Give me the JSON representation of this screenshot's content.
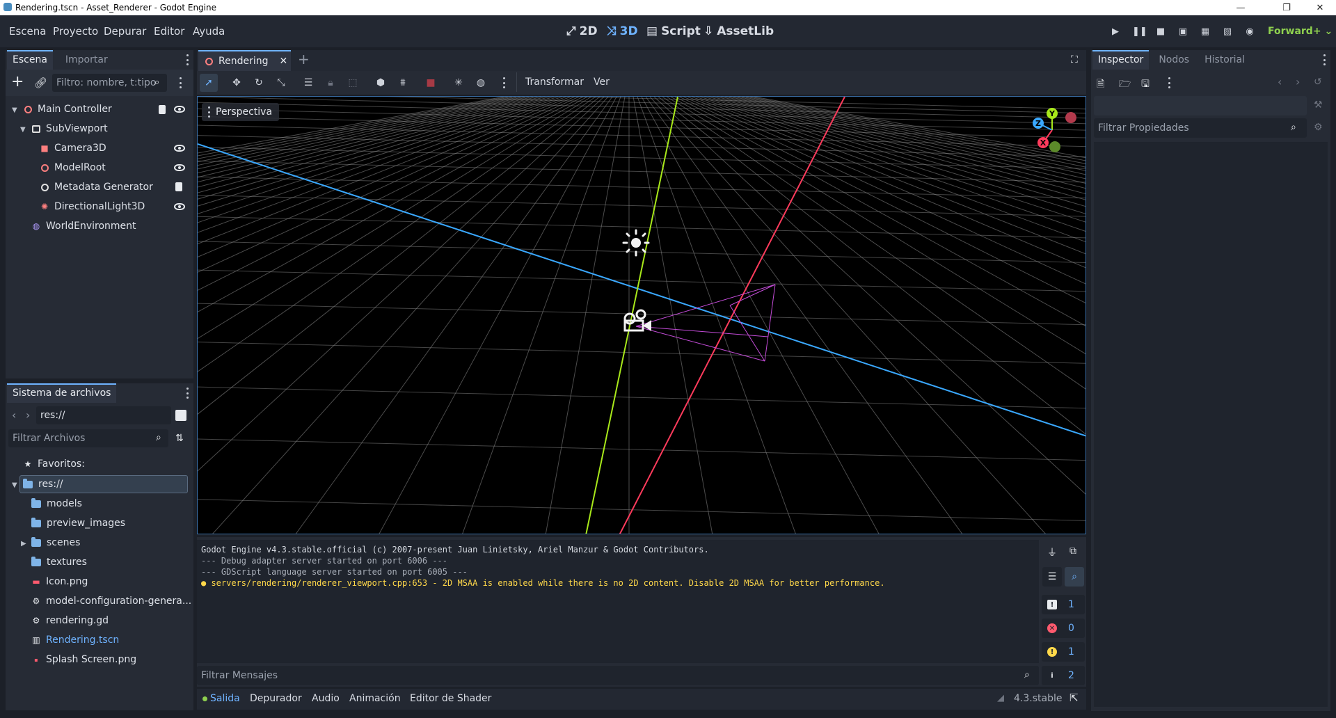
{
  "window": {
    "title": "Rendering.tscn - Asset_Renderer - Godot Engine",
    "minimize": "—",
    "maximize": "❐",
    "close": "✕"
  },
  "menu": [
    "Escena",
    "Proyecto",
    "Depurar",
    "Editor",
    "Ayuda"
  ],
  "workspaces": [
    {
      "label": "2D",
      "icon": "2d-icon",
      "active": false
    },
    {
      "label": "3D",
      "icon": "3d-icon",
      "active": true
    },
    {
      "label": "Script",
      "icon": "script-icon",
      "active": false
    },
    {
      "label": "AssetLib",
      "icon": "assetlib-icon",
      "active": false
    }
  ],
  "renderer": "Forward+",
  "scene_dock": {
    "tabs": [
      "Escena",
      "Importar"
    ],
    "filter_placeholder": "Filtro: nombre, t:tipo",
    "nodes": [
      {
        "label": "Main Controller",
        "icon": "node3d-icon",
        "color": "#fc7f7f"
      },
      {
        "label": "SubViewport",
        "icon": "subviewport-icon",
        "color": "#e0e0e0"
      },
      {
        "label": "Camera3D",
        "icon": "camera3d-icon",
        "color": "#fc7f7f"
      },
      {
        "label": "ModelRoot",
        "icon": "node3d-icon",
        "color": "#fc7f7f"
      },
      {
        "label": "Metadata Generator",
        "icon": "node-icon",
        "color": "#e0e0e0"
      },
      {
        "label": "DirectionalLight3D",
        "icon": "light-icon",
        "color": "#fc7f7f"
      },
      {
        "label": "WorldEnvironment",
        "icon": "world-environment-icon",
        "color": "#b19cff"
      }
    ]
  },
  "filesystem": {
    "tab": "Sistema de archivos",
    "path": "res://",
    "filter_placeholder": "Filtrar Archivos",
    "favorites": "Favoritos:",
    "items": [
      {
        "label": "res://",
        "type": "folder"
      },
      {
        "label": "models",
        "type": "folder"
      },
      {
        "label": "preview_images",
        "type": "folder"
      },
      {
        "label": "scenes",
        "type": "folder"
      },
      {
        "label": "textures",
        "type": "folder"
      },
      {
        "label": "Icon.png",
        "type": "image"
      },
      {
        "label": "model-configuration-genera...",
        "type": "gear"
      },
      {
        "label": "rendering.gd",
        "type": "gear"
      },
      {
        "label": "Rendering.tscn",
        "type": "scene"
      },
      {
        "label": "Splash Screen.png",
        "type": "image"
      }
    ]
  },
  "editor_tab": {
    "label": "Rendering",
    "close": "✕",
    "add": "+"
  },
  "toolbar": {
    "transform": "Transformar",
    "view": "Ver"
  },
  "viewport": {
    "perspective_label": "Perspectiva",
    "gizmo": {
      "y": "Y",
      "z": "Z",
      "x": "X"
    }
  },
  "output": {
    "lines": [
      {
        "text": "Godot Engine v4.3.stable.official (c) 2007-present Juan Linietsky, Ariel Manzur & Godot Contributors.",
        "kind": "normal"
      },
      {
        "text": "--- Debug adapter server started on port 6006 ---",
        "kind": "dim"
      },
      {
        "text": "--- GDScript language server started on port 6005 ---",
        "kind": "dim"
      },
      {
        "text": "● servers/rendering/renderer_viewport.cpp:653 - 2D MSAA is enabled while there is no 2D content. Disable 2D MSAA for better performance.",
        "kind": "warn"
      }
    ],
    "filter_placeholder": "Filtrar Mensajes",
    "counters": {
      "messages": "1",
      "errors": "0",
      "warnings": "1",
      "info": "2"
    }
  },
  "inspector": {
    "tabs": [
      "Inspector",
      "Nodos",
      "Historial"
    ],
    "filter_placeholder": "Filtrar Propiedades"
  },
  "bottom_panel": {
    "tabs": [
      "Salida",
      "Depurador",
      "Audio",
      "Animación",
      "Editor de Shader"
    ],
    "version": "4.3.stable"
  },
  "colors": {
    "accent": "#6fb3ff",
    "x_axis": "#ff3b5c",
    "y_axis": "#a8e81a",
    "z_axis": "#3aa8ff",
    "warning": "#ffd84a"
  }
}
